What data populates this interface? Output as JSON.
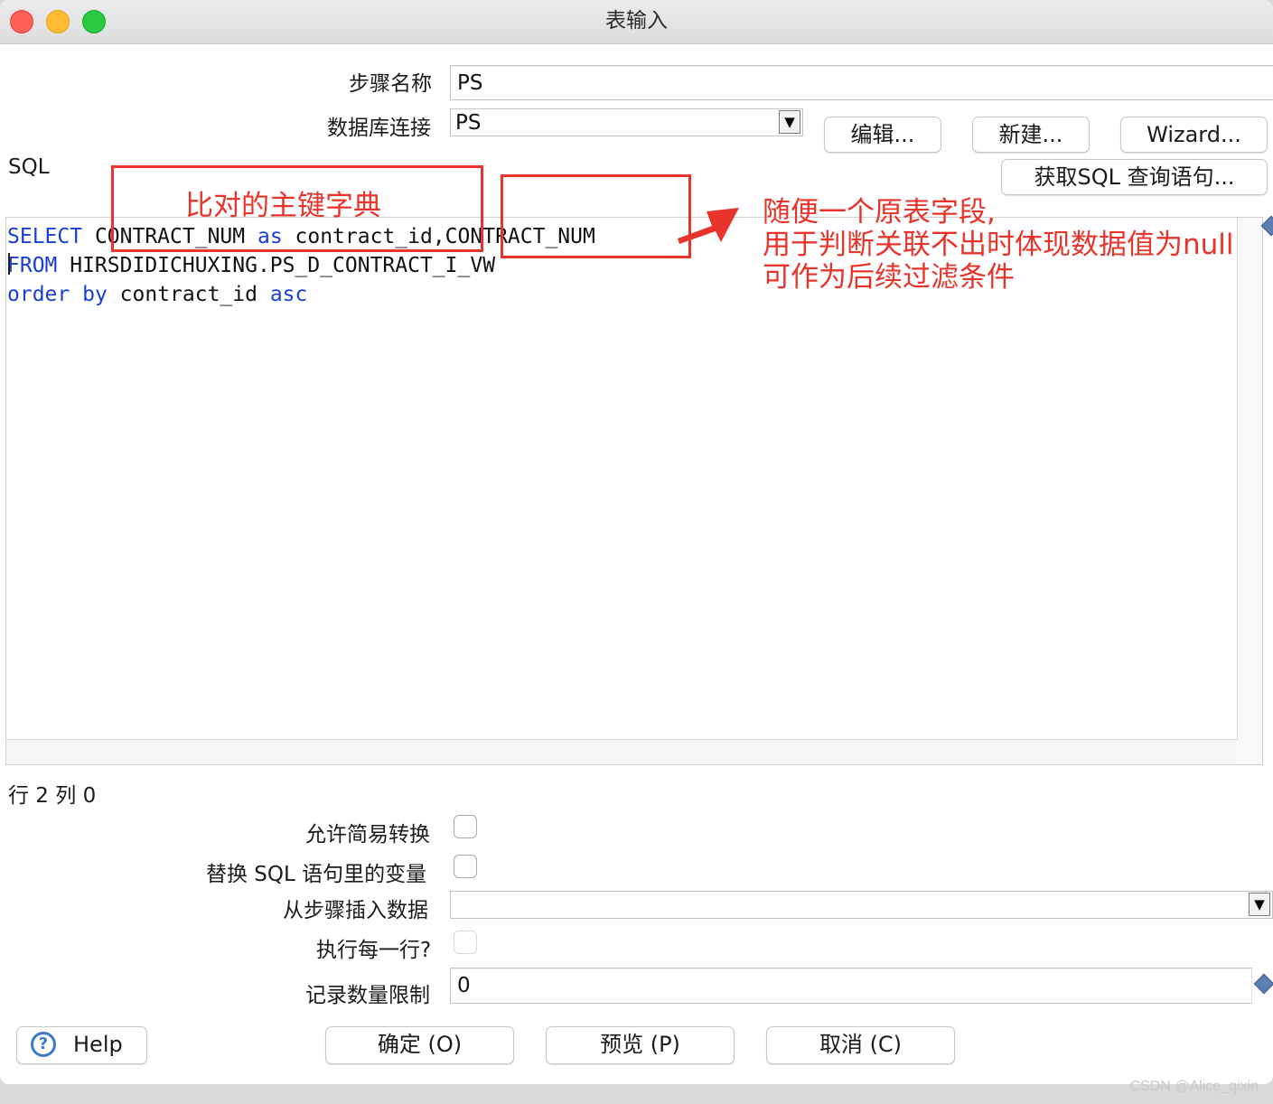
{
  "window": {
    "title": "表输入"
  },
  "form": {
    "step_name_label": "步骤名称",
    "step_name_value": "PS",
    "db_conn_label": "数据库连接",
    "db_conn_value": "PS",
    "edit_button": "编辑...",
    "new_button": "新建...",
    "wizard_button": "Wizard...",
    "sql_label": "SQL",
    "get_sql_button": "获取SQL 查询语句..."
  },
  "sql": {
    "line1": {
      "kw1": "SELECT",
      "t1": " CONTRACT_NUM ",
      "kw2": "as",
      "t2": " contract_id,CONTRACT_NUM"
    },
    "line2": {
      "kw1": "FROM",
      "t1": " HIRSDIDICHUXING.PS_D_CONTRACT_I_VW"
    },
    "line3": {
      "kw1": "order",
      "t1": " ",
      "kw2": "by",
      "t2": " contract_id ",
      "kw3": "asc"
    }
  },
  "status": {
    "position": "行 2 列 0"
  },
  "options": {
    "lazy_conversion_label": "允许简易转换",
    "replace_vars_label": "替换 SQL 语句里的变量",
    "insert_from_step_label": "从步骤插入数据",
    "insert_from_step_value": "",
    "execute_each_row_label": "执行每一行?",
    "limit_label": "记录数量限制",
    "limit_value": "0"
  },
  "footer": {
    "help_button": "Help",
    "ok_button": "确定 (O)",
    "preview_button": "预览 (P)",
    "cancel_button": "取消 (C)"
  },
  "annotations": {
    "primary_key_note": "比对的主键字典",
    "field_note_line1": "随便一个原表字段,",
    "field_note_line2": "用于判断关联不出时体现数据值为null",
    "field_note_line3": "可作为后续过滤条件",
    "accent_color": "#e8342a"
  },
  "watermark": "CSDN @Alice_qixin"
}
